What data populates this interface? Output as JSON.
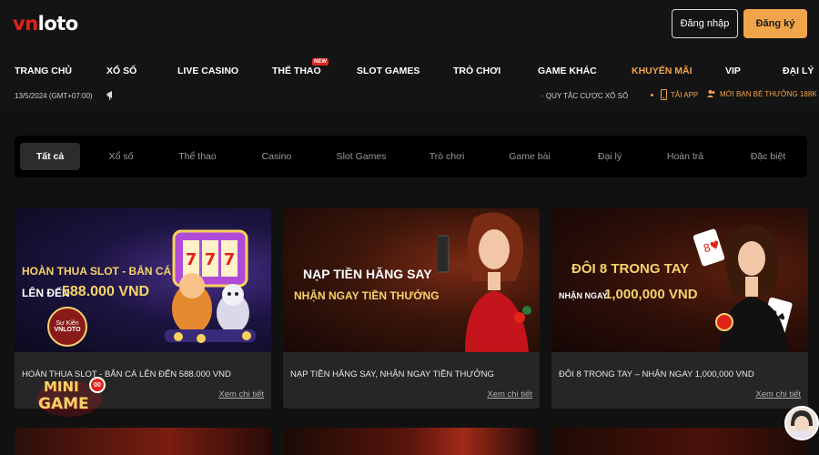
{
  "header": {
    "logo_vn": "vn",
    "logo_rest": "loto",
    "login_label": "Đăng nhập",
    "register_label": "Đăng ký"
  },
  "nav": {
    "items": [
      "TRANG CHỦ",
      "XỔ SỐ",
      "LIVE CASINO",
      "THỂ THAO",
      "SLOT GAMES",
      "TRÒ CHƠI",
      "GAME KHÁC",
      "KHUYẾN MÃI",
      "VIP",
      "ĐẠI LÝ"
    ],
    "active": "KHUYẾN MÃI",
    "new_badge": "NEW"
  },
  "subbar": {
    "date": "13/5/2024 (GMT+07:00)",
    "rules": "· QUY TẮC CƯỢC XỔ SỐ",
    "app": "TẢI APP",
    "invite": "MỜI BẠN BÈ THƯỞNG 188K"
  },
  "tabs": {
    "items": [
      "Tất cả",
      "Xổ số",
      "Thể thao",
      "Casino",
      "Slot Games",
      "Trò chơi",
      "Game bài",
      "Đại lý",
      "Hoàn trả",
      "Đặc biệt"
    ],
    "active": "Tất cả"
  },
  "cards": [
    {
      "banner_line1": "HOÀN THUA SLOT - BẮN CÁ",
      "banner_line2a": "LÊN ĐẾN",
      "banner_line2b": "588.000 VND",
      "badge_line1": "Sự Kiện",
      "badge_line2": "VNLOTO",
      "caption": "HOÀN THUA SLOT - BẮN CÁ LÊN ĐẾN 588.000 VND",
      "more": "Xem chi tiết"
    },
    {
      "banner_line1": "NẠP TIỀN HĂNG SAY",
      "banner_line2": "NHẬN NGAY TIỀN THƯỞNG",
      "caption": "NẠP TIỀN HĂNG SAY, NHẬN NGAY TIỀN THƯỞNG",
      "more": "Xem chi tiết"
    },
    {
      "banner_line1": "ĐÔI 8 TRONG TAY",
      "banner_line2a": "NHẬN NGAY",
      "banner_line2b": "1,000,000 VND",
      "caption": "ĐÔI 8 TRONG TAY – NHẬN NGAY 1,000,000 VND",
      "more": "Xem chi tiết"
    }
  ],
  "minigame": {
    "line1": "MINI",
    "line2": "GAME",
    "count": "00"
  },
  "colors": {
    "accent": "#f2a44a",
    "brand_red": "#e2231a",
    "background": "#111112",
    "card": "#262626"
  }
}
